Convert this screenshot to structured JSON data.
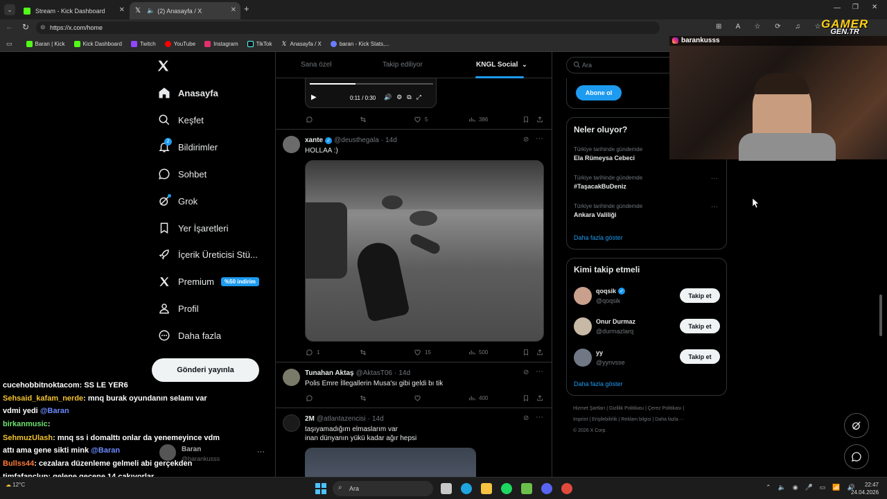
{
  "browser": {
    "tabs": [
      {
        "title": "Stream - Kick Dashboard",
        "active": false
      },
      {
        "title": "(2) Anasayfa / X",
        "active": true
      }
    ],
    "url": "https://x.com/home",
    "bookmarks": [
      "Baran | Kick",
      "Kick Dashboard",
      "Twitch",
      "YouTube",
      "Instagram",
      "TikTok",
      "Anasayfa / X",
      "baran - Kick Stats,..."
    ]
  },
  "overlay": {
    "logo_top": "GAMER",
    "logo_bottom": "GEN.TR",
    "cam_name": "barankusss"
  },
  "nav": {
    "items": [
      {
        "label": "Anasayfa",
        "icon": "home-icon",
        "active": true
      },
      {
        "label": "Keşfet",
        "icon": "search-icon"
      },
      {
        "label": "Bildirimler",
        "icon": "bell-icon",
        "badge": "2"
      },
      {
        "label": "Sohbet",
        "icon": "chat-icon"
      },
      {
        "label": "Grok",
        "icon": "grok-icon"
      },
      {
        "label": "Yer İşaretleri",
        "icon": "bookmark-icon"
      },
      {
        "label": "İçerik Üreticisi Stü...",
        "icon": "rocket-icon"
      },
      {
        "label": "Premium",
        "icon": "x-logo-icon",
        "badge": "%50 indirim"
      },
      {
        "label": "Profil",
        "icon": "person-icon"
      },
      {
        "label": "Daha fazla",
        "icon": "more-circle-icon"
      }
    ],
    "post_button": "Gönderi yayınla",
    "account_name": "Baran",
    "account_handle": "@barankusss"
  },
  "feed": {
    "tabs": [
      "Sana özel",
      "Takip ediliyor",
      "KNGL Social"
    ],
    "video": {
      "time": "0:11 / 0:30",
      "progress": 0.37
    },
    "first_stats": {
      "likes": "5",
      "views": "386"
    },
    "tweets": [
      {
        "name": "xante",
        "handle": "@deusthegala",
        "age": "14d",
        "verified": true,
        "text": "HOLLAA :)",
        "replies": "1",
        "retweets": "",
        "likes": "15",
        "views": "500"
      },
      {
        "name": "Tunahan Aktaş",
        "handle": "@AktasT06",
        "age": "14d",
        "verified": false,
        "text": "Polis Emre İllegallerin Musa'sı gibi geldi  bı tik",
        "replies": "",
        "retweets": "",
        "likes": "",
        "views": "400"
      },
      {
        "name": "2M",
        "handle": "@atlantazencisi",
        "age": "14d",
        "verified": false,
        "text": "taşıyamadığım elmaslarım var",
        "text2": "inan dünyanın yükü kadar ağır hepsi"
      }
    ]
  },
  "sidebar": {
    "search_placeholder": "Ara",
    "subscribe": "Abone ol",
    "trends_title": "Neler oluyor?",
    "trends": [
      {
        "context": "Türkiye tarihinde gündemde",
        "name": "Ela Rümeysa Cebeci"
      },
      {
        "context": "Türkiye tarihinde gündemde",
        "name": "#TaşacakBuDeniz"
      },
      {
        "context": "Türkiye tarihinde gündemde",
        "name": "Ankara Valiliği"
      }
    ],
    "show_more": "Daha fazla göster",
    "follow_title": "Kimi takip etmeli",
    "follow": [
      {
        "name": "qoqsik",
        "handle": "@qoqsik",
        "verified": true
      },
      {
        "name": "Onur Durmaz",
        "handle": "@durmazlarq",
        "verified": false
      },
      {
        "name": "yy",
        "handle": "@yynvsse",
        "verified": false
      }
    ],
    "follow_button": "Takip et",
    "footer_line1": "Hizmet Şartları  |  Gizlilik Politikası  |  Çerez Politikası  |",
    "footer_line2": "Imprint  |  Erişilebilirlik  |  Reklam bilgisi  |  Daha fazla ···",
    "footer_line3": "© 2026 X Corp."
  },
  "chat": [
    {
      "user": "cucehobbitnoktacom",
      "color": "#fff",
      "msg": ": SS LE YER6"
    },
    {
      "user": "Sehsaid_kafam_nerde",
      "color": "#f2c230",
      "msg": ": mnq burak oyundanın selamı var"
    },
    {
      "user": "",
      "color": "#fff",
      "msg": "vdmi yedi",
      "mention": "@Baran"
    },
    {
      "user": "birkanmusic",
      "color": "#6ee36e",
      "msg": ":"
    },
    {
      "user": "SehmuzUlash",
      "color": "#f2c230",
      "msg": ": mnq ss i domalttı onlar da yenemeyince vdm"
    },
    {
      "user": "",
      "color": "#fff",
      "msg": "attı ama gene sikti mink",
      "mention": "@Baran"
    },
    {
      "user": "Bullss44",
      "color": "#ff7b3a",
      "msg": ": cezalara düzenleme gelmeli abi gerçekden"
    },
    {
      "user": "timfafanclup",
      "color": "#fff",
      "msg": ": gelene gecene 14 cakıyorlar"
    }
  ],
  "taskbar": {
    "search": "Ara",
    "weather": "12°C",
    "time": "22:47",
    "date": "24.04.2026"
  }
}
